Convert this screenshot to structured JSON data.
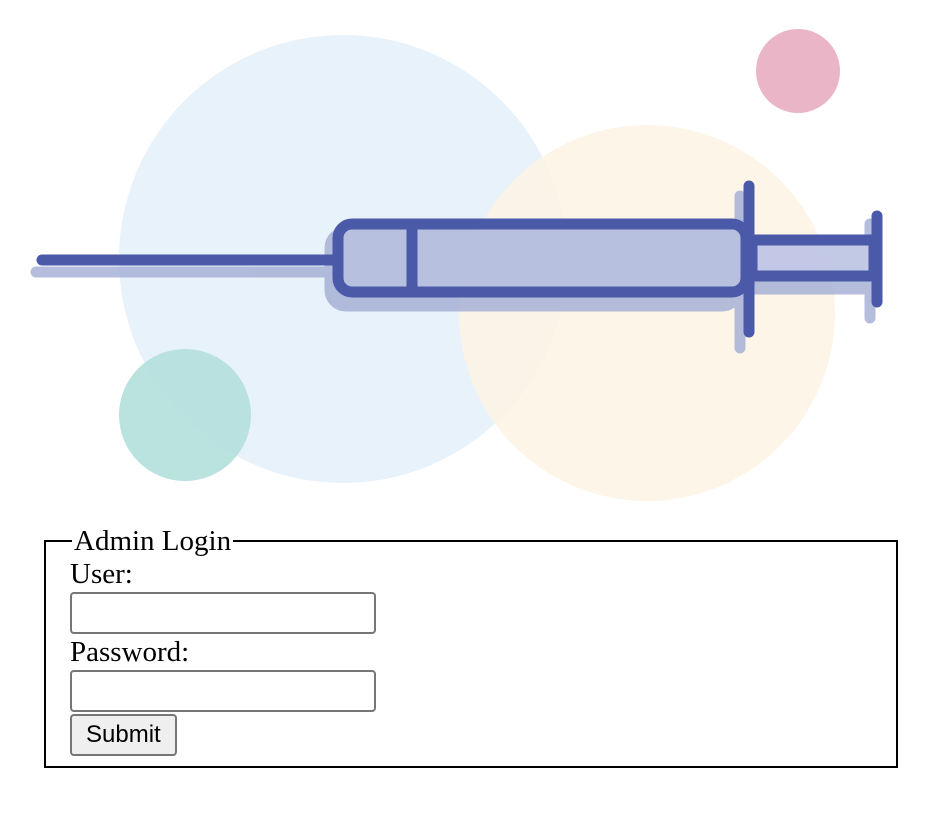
{
  "hero": {
    "illustration": "syringe-icon",
    "colors": {
      "syringe_stroke": "#4a5ca8",
      "syringe_shadow": "#a9b4d8",
      "barrel_fill": "#b9c3e0",
      "circle_blue": "#e8f2f9",
      "circle_yellow": "#fdf4e6",
      "circle_pink": "#ebb7c9",
      "circle_teal": "#b7e1df"
    }
  },
  "login": {
    "legend": "Admin Login",
    "user_label": "User:",
    "user_value": "",
    "password_label": "Password:",
    "password_value": "",
    "submit_label": "Submit"
  }
}
